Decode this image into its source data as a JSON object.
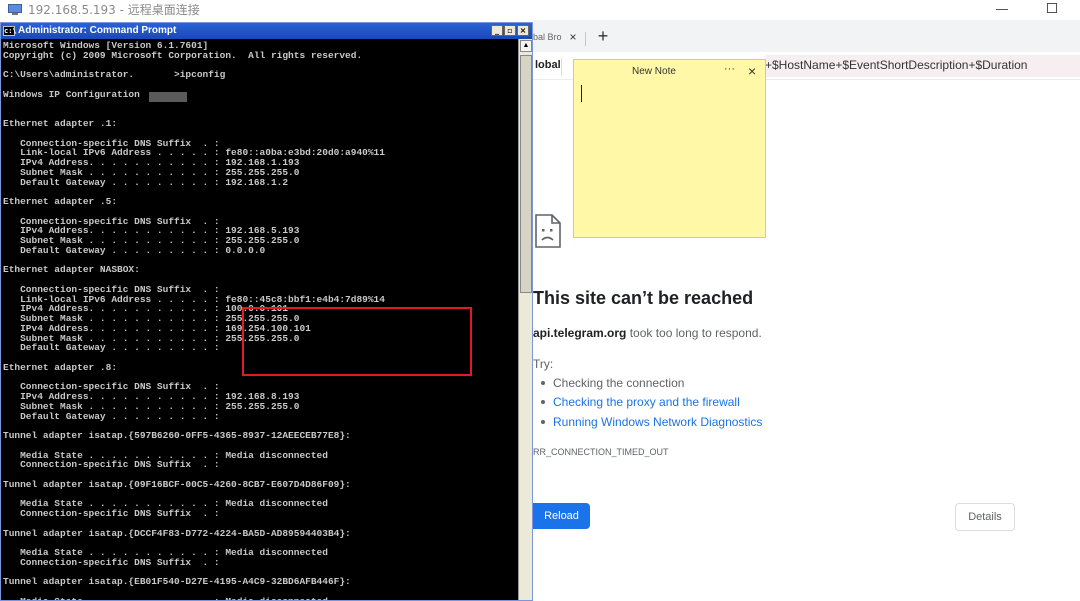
{
  "window": {
    "title": "192.168.5.193 - 远程桌面连接"
  },
  "browser": {
    "tab_fragment": "bal Bro",
    "tab_close": "×",
    "new_tab": "+",
    "toolbar_fragment": "lobal",
    "formula": "+$HostName+$EventShortDescription+$Duration",
    "error": {
      "title": "This site can’t be reached",
      "host": "api.telegram.org",
      "host_suffix": " took too long to respond.",
      "try_label": "Try:",
      "suggestions": [
        "Checking the connection",
        "Checking the proxy and the firewall",
        "Running Windows Network Diagnostics"
      ],
      "code": "RR_CONNECTION_TIMED_OUT",
      "reload_label": "Reload",
      "details_label": "Details"
    },
    "colors": {
      "link": "#1a73e8",
      "button": "#1a73e8"
    }
  },
  "note": {
    "title": "New Note",
    "more": "···",
    "close": "×"
  },
  "cmd": {
    "title": "Administrator: Command Prompt",
    "icon_text": "c:\\",
    "controls": [
      "_",
      "▫",
      "×"
    ],
    "lines": [
      "Microsoft Windows [Version 6.1.7601]",
      "Copyright (c) 2009 Microsoft Corporation.  All rights reserved.",
      "",
      "C:\\Users\\administrator.       >ipconfig",
      "",
      "Windows IP Configuration",
      "",
      "",
      "Ethernet adapter .1:",
      "",
      "   Connection-specific DNS Suffix  . :",
      "   Link-local IPv6 Address . . . . . : fe80::a0ba:e3bd:20d0:a940%11",
      "   IPv4 Address. . . . . . . . . . . : 192.168.1.193",
      "   Subnet Mask . . . . . . . . . . . : 255.255.255.0",
      "   Default Gateway . . . . . . . . . : 192.168.1.2",
      "",
      "Ethernet adapter .5:",
      "",
      "   Connection-specific DNS Suffix  . :",
      "   IPv4 Address. . . . . . . . . . . : 192.168.5.193",
      "   Subnet Mask . . . . . . . . . . . : 255.255.255.0",
      "   Default Gateway . . . . . . . . . : 0.0.0.0",
      "",
      "Ethernet adapter NASBOX:",
      "",
      "   Connection-specific DNS Suffix  . :",
      "   Link-local IPv6 Address . . . . . : fe80::45c8:bbf1:e4b4:7d89%14",
      "   IPv4 Address. . . . . . . . . . . : 100.0.0.101",
      "   Subnet Mask . . . . . . . . . . . : 255.255.255.0",
      "   IPv4 Address. . . . . . . . . . . : 169.254.100.101",
      "   Subnet Mask . . . . . . . . . . . : 255.255.255.0",
      "   Default Gateway . . . . . . . . . :",
      "",
      "Ethernet adapter .8:",
      "",
      "   Connection-specific DNS Suffix  . :",
      "   IPv4 Address. . . . . . . . . . . : 192.168.8.193",
      "   Subnet Mask . . . . . . . . . . . : 255.255.255.0",
      "   Default Gateway . . . . . . . . . :",
      "",
      "Tunnel adapter isatap.{597B6260-0FF5-4365-8937-12AEECEB77E8}:",
      "",
      "   Media State . . . . . . . . . . . : Media disconnected",
      "   Connection-specific DNS Suffix  . :",
      "",
      "Tunnel adapter isatap.{09F16BCF-00C5-4260-8CB7-E607D4D86F09}:",
      "",
      "   Media State . . . . . . . . . . . : Media disconnected",
      "   Connection-specific DNS Suffix  . :",
      "",
      "Tunnel adapter isatap.{DCCF4F83-D772-4224-BA5D-AD89594403B4}:",
      "",
      "   Media State . . . . . . . . . . . : Media disconnected",
      "   Connection-specific DNS Suffix  . :",
      "",
      "Tunnel adapter isatap.{EB01F540-D27E-4195-A4C9-32BD6AFB446F}:",
      "",
      "   Media State . . . . . . . . . . . : Media disconnected"
    ],
    "colors": {
      "text": "#c8c8c8",
      "background": "#000000",
      "highlight": "#e01b24"
    }
  }
}
